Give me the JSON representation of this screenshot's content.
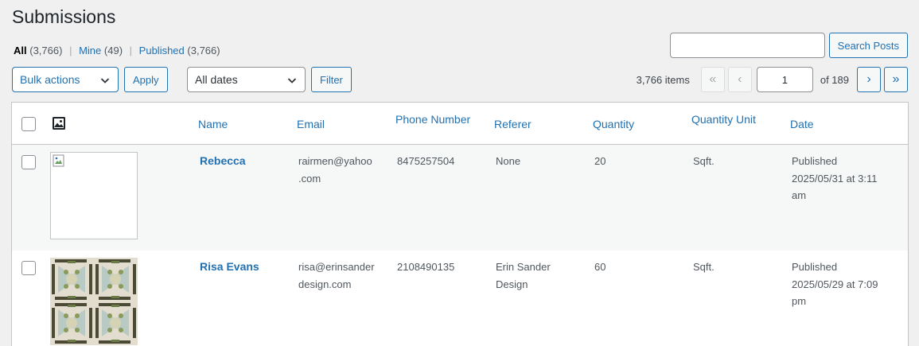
{
  "page": {
    "title": "Submissions"
  },
  "views": {
    "all_label": "All",
    "all_count": "(3,766)",
    "mine_label": "Mine",
    "mine_count": "(49)",
    "published_label": "Published",
    "published_count": "(3,766)",
    "separator": "|"
  },
  "search": {
    "value": "",
    "button_label": "Search Posts"
  },
  "bulk": {
    "selected": "Bulk actions",
    "apply_label": "Apply"
  },
  "dates": {
    "selected": "All dates",
    "filter_label": "Filter"
  },
  "pagination": {
    "items": "3,766 items",
    "first": "«",
    "prev": "‹",
    "current_page": "1",
    "of_total": "of 189",
    "next": "›",
    "last": "»"
  },
  "columns": {
    "name": "Name",
    "email": "Email",
    "phone": "Phone Number",
    "referer": "Referer",
    "quantity": "Quantity",
    "quantity_unit": "Quantity Unit",
    "date": "Date"
  },
  "rows": [
    {
      "name": "Rebecca",
      "email_line1": "rairmen@yahoo",
      "email_line2": ".com",
      "phone": "8475257504",
      "referer_line1": "None",
      "referer_line2": "",
      "quantity": "20",
      "quantity_unit": "Sqft.",
      "status": "Published",
      "date_line1": "2025/05/31 at 3:11",
      "date_line2": "am",
      "thumb": "broken-image-icon"
    },
    {
      "name": "Risa Evans",
      "email_line1": "risa@erinsander",
      "email_line2": "design.com",
      "phone": "2108490135",
      "referer_line1": "Erin Sander",
      "referer_line2": "Design",
      "quantity": "60",
      "quantity_unit": "Sqft.",
      "status": "Published",
      "date_line1": "2025/05/29 at 7:09",
      "date_line2": "pm",
      "thumb": "tile-pattern-image"
    }
  ],
  "colors": {
    "accent": "#2271b1",
    "background": "#f0f0f1",
    "text": "#3c434a"
  }
}
